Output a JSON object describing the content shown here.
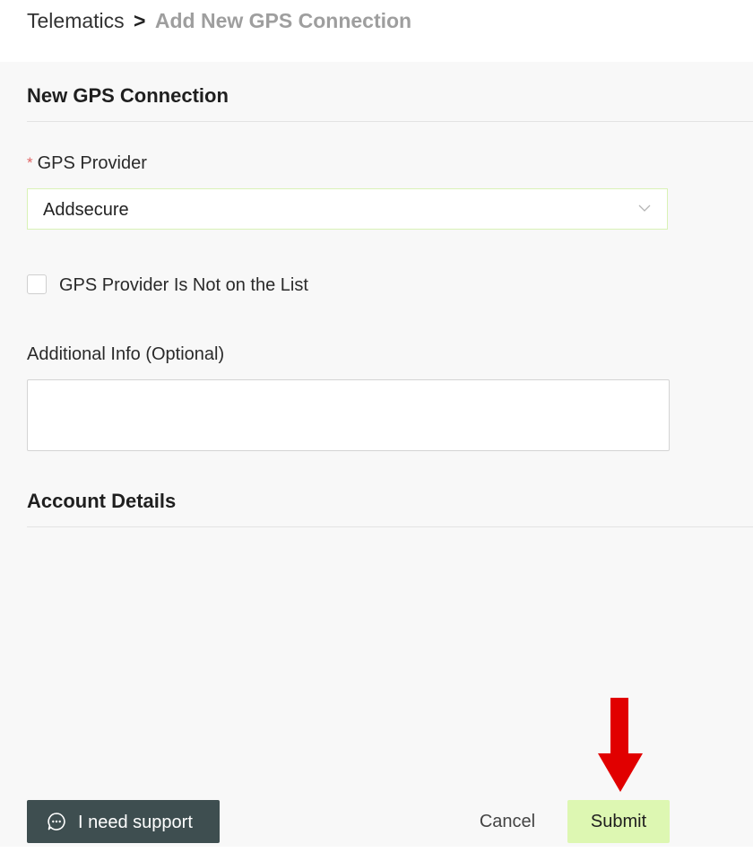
{
  "breadcrumb": {
    "root": "Telematics",
    "separator": ">",
    "current": "Add New GPS Connection"
  },
  "form": {
    "title": "New GPS Connection",
    "provider": {
      "required_marker": "*",
      "label": "GPS Provider",
      "value": "Addsecure"
    },
    "not_on_list": {
      "label": "GPS Provider Is Not on the List",
      "checked": false
    },
    "additional_info": {
      "label": "Additional Info (Optional)",
      "value": ""
    },
    "account_details_title": "Account Details"
  },
  "footer": {
    "support_label": "I need support",
    "cancel_label": "Cancel",
    "submit_label": "Submit"
  },
  "icons": {
    "dropdown": "chevron-down-icon",
    "support": "chat-bubble-icon",
    "annotation": "red-arrow-icon"
  },
  "colors": {
    "submit_bg": "#ddf7b2",
    "support_bg": "#3e4e50",
    "required": "#e06666",
    "annotation_arrow": "#e10000"
  }
}
